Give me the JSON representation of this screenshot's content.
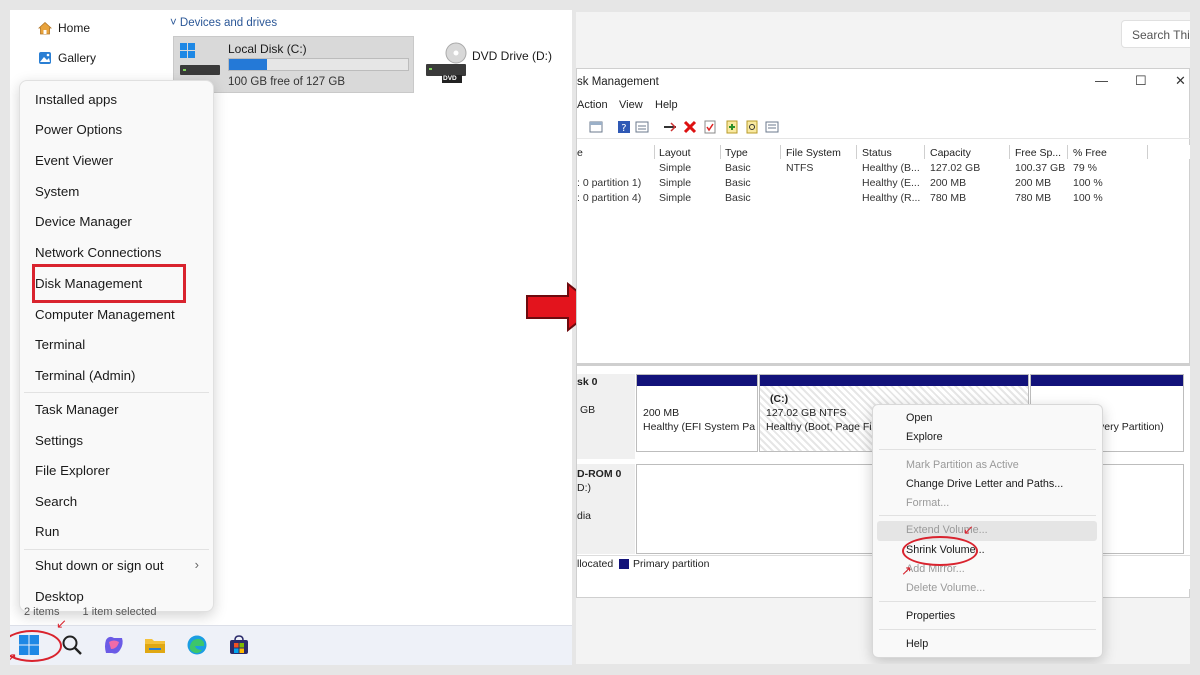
{
  "explorer": {
    "nav": [
      {
        "label": "Home",
        "icon": "home-icon"
      },
      {
        "label": "Gallery",
        "icon": "gallery-icon"
      }
    ],
    "section_header": "Devices and drives",
    "drives": [
      {
        "name": "Local Disk (C:)",
        "free": "100 GB free of 127 GB",
        "used_fraction": 0.21
      },
      {
        "name": "DVD Drive (D:)",
        "badge": "DVD"
      }
    ],
    "status_bar": {
      "items": "2 items",
      "selected": "1 item selected"
    }
  },
  "start_context_menu": {
    "items": [
      "Installed apps",
      "Power Options",
      "Event Viewer",
      "System",
      "Device Manager",
      "Network Connections",
      "Disk Management",
      "Computer Management",
      "Terminal",
      "Terminal (Admin)",
      "Task Manager",
      "Settings",
      "File Explorer",
      "Search",
      "Run",
      "Shut down or sign out",
      "Desktop"
    ],
    "highlighted": "Disk Management",
    "highlight_color": "#d9232e"
  },
  "taskbar": {
    "icons": [
      "windows-start-icon",
      "search-icon",
      "copilot-icon",
      "file-explorer-icon",
      "edge-icon",
      "store-icon"
    ]
  },
  "arrow_color": "#e3141d",
  "disk_management": {
    "search_placeholder": "Search Thi",
    "title": "sk Management",
    "menu": [
      "Action",
      "View",
      "Help"
    ],
    "columns": [
      "e",
      "Layout",
      "Type",
      "File System",
      "Status",
      "Capacity",
      "Free Sp...",
      "% Free"
    ],
    "rows": [
      [
        "",
        "Simple",
        "Basic",
        "NTFS",
        "Healthy (B...",
        "127.02 GB",
        "100.37 GB",
        "79 %"
      ],
      [
        ": 0 partition 1)",
        "Simple",
        "Basic",
        "",
        "Healthy (E...",
        "200 MB",
        "200 MB",
        "100 %"
      ],
      [
        ": 0 partition 4)",
        "Simple",
        "Basic",
        "",
        "Healthy (R...",
        "780 MB",
        "780 MB",
        "100 %"
      ]
    ],
    "disk0": {
      "label": "sk 0",
      "size_fragment": "GB",
      "efi": {
        "size": "200 MB",
        "status": "Healthy (EFI System Pa"
      },
      "c": {
        "name": "(C:)",
        "size": "127.02 GB NTFS",
        "status": "Healthy (Boot, Page Fil"
      },
      "recovery": {
        "status": "very Partition)"
      }
    },
    "cdrom": {
      "label": "D-ROM 0",
      "sub": "D:)",
      "media": "dia"
    },
    "legend": {
      "unallocated": "llocated",
      "primary": "Primary partition",
      "primary_color": "#12127a"
    },
    "context_menu": {
      "items": [
        {
          "label": "Open",
          "disabled": false
        },
        {
          "label": "Explore",
          "disabled": false
        },
        {
          "label": "Mark Partition as Active",
          "disabled": true
        },
        {
          "label": "Change Drive Letter and Paths...",
          "disabled": false
        },
        {
          "label": "Format...",
          "disabled": true
        },
        {
          "label": "Extend Volume...",
          "disabled": true
        },
        {
          "label": "Shrink Volume...",
          "disabled": false
        },
        {
          "label": "Add Mirror...",
          "disabled": true
        },
        {
          "label": "Delete Volume...",
          "disabled": true
        },
        {
          "label": "Properties",
          "disabled": false
        },
        {
          "label": "Help",
          "disabled": false
        }
      ],
      "circled": "Shrink Volume..."
    }
  }
}
